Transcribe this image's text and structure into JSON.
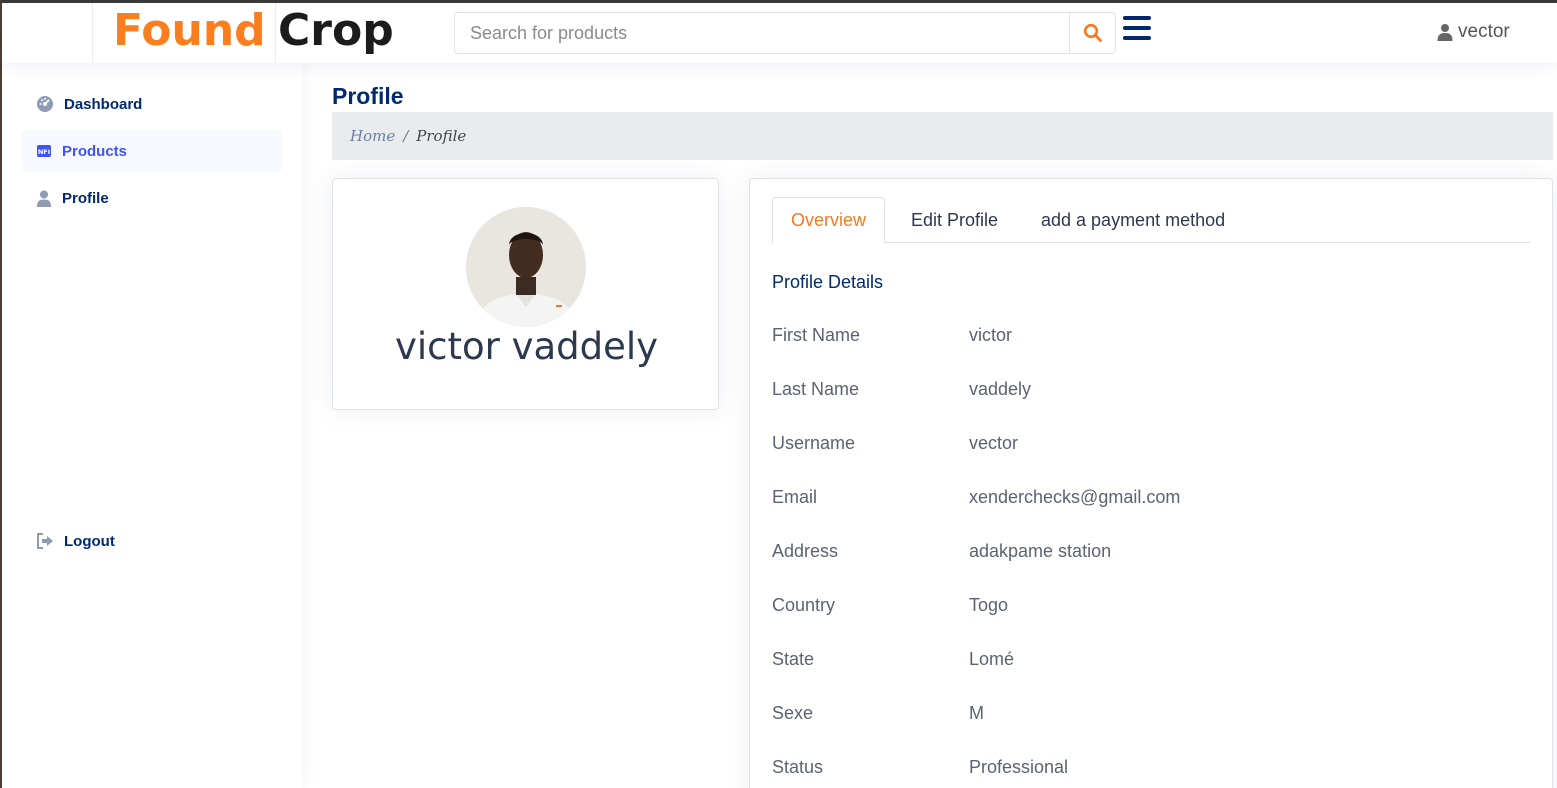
{
  "brand": {
    "part1": "Found",
    "part2": "Crop",
    "part1_color": "#fb7e1e",
    "part2_color": "#1c1c1c"
  },
  "header": {
    "search_placeholder": "Search for products",
    "search_icon": "search-icon",
    "menu_icon": "hamburger-menu-icon",
    "username": "vector"
  },
  "sidebar": {
    "items": [
      {
        "label": "Dashboard",
        "icon": "dashboard-gauge-icon",
        "active": false
      },
      {
        "label": "Products",
        "icon": "nft-icon",
        "active": true
      },
      {
        "label": "Profile",
        "icon": "person-icon",
        "active": false
      }
    ],
    "logout": {
      "label": "Logout",
      "icon": "logout-icon"
    }
  },
  "page": {
    "title": "Profile",
    "breadcrumb": [
      "Home",
      "Profile"
    ]
  },
  "profile_card": {
    "full_name": "victor vaddely"
  },
  "tabs": [
    "Overview",
    "Edit Profile",
    "add a payment method"
  ],
  "details": {
    "title": "Profile Details",
    "rows": [
      {
        "label": "First Name",
        "value": "victor"
      },
      {
        "label": "Last Name",
        "value": "vaddely"
      },
      {
        "label": "Username",
        "value": "vector"
      },
      {
        "label": "Email",
        "value": "xenderchecks@gmail.com"
      },
      {
        "label": "Address",
        "value": "adakpame station"
      },
      {
        "label": "Country",
        "value": "Togo"
      },
      {
        "label": "State",
        "value": "Lomé"
      },
      {
        "label": "Sexe",
        "value": "M"
      },
      {
        "label": "Status",
        "value": "Professional"
      }
    ]
  },
  "colors": {
    "accent": "#f47920",
    "navy": "#012970",
    "active_nav": "#4154f1"
  }
}
